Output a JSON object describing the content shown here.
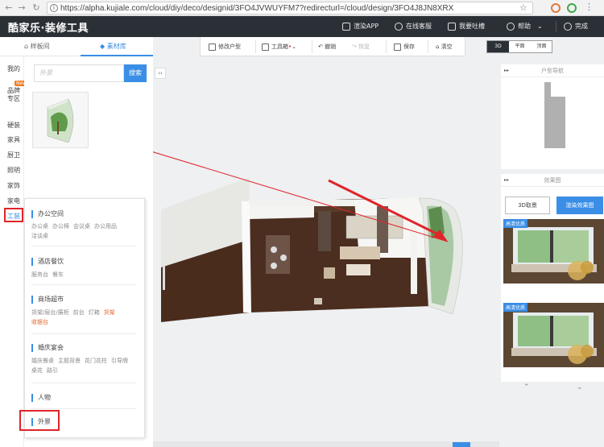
{
  "browser": {
    "url": "https://alpha.kujiale.com/cloud/diy/deco/designid/3FO4JVWUYFM7?redirecturl=/cloud/design/3FO4J8JN8XRX",
    "icons": [
      "back-icon",
      "forward-icon",
      "reload-icon",
      "info-icon",
      "star-icon"
    ]
  },
  "header": {
    "logo": "酷家乐·装修工具",
    "render_app": "渲染APP",
    "online_service": "在线客服",
    "feedback": "我要吐槽",
    "help": "帮助",
    "done": "完成"
  },
  "left_tabs": {
    "sample": "样板间",
    "material": "素材库"
  },
  "categories": [
    {
      "label": "我的"
    },
    {
      "label": "品牌专区"
    },
    {
      "label": "硬装"
    },
    {
      "label": "家具"
    },
    {
      "label": "厨卫"
    },
    {
      "label": "照明"
    },
    {
      "label": "家饰"
    },
    {
      "label": "家电"
    },
    {
      "label": "工装"
    }
  ],
  "new_badge": "New",
  "search": {
    "placeholder": "外景",
    "button": "搜索"
  },
  "popup": {
    "sections": [
      {
        "title": "办公空间",
        "items": [
          "办公桌",
          "办公椅",
          "会议桌",
          "办公用品",
          "洽谈桌"
        ]
      },
      {
        "title": "酒店餐饮",
        "items": [
          "服务台",
          "餐车"
        ]
      },
      {
        "title": "商场超市",
        "items": [
          "货架/层台/展柜",
          "前台",
          "灯箱",
          "货架",
          "收银台"
        ]
      },
      {
        "title": "婚庆宴会",
        "items": [
          "婚庆餐桌",
          "主题背景",
          "花门花柱",
          "引导牌",
          "桌花",
          "路引"
        ]
      },
      {
        "title": "人物",
        "items": []
      },
      {
        "title": "外景",
        "items": []
      }
    ]
  },
  "toolbar": {
    "edit_floorplan": "修改户型",
    "toolbox": "工具箱",
    "undo": "撤销",
    "redo": "恢复",
    "save": "保存",
    "clear": "清空"
  },
  "view_modes": [
    "3D",
    "平面",
    "顶面"
  ],
  "right": {
    "nav_title": "户型导航",
    "effect_title": "效果图",
    "capture_btn": "3D取景",
    "render_btn": "渲染效果图",
    "hq_tag": "高清优质",
    "hq_tag2": "高清优质"
  },
  "colors": {
    "accent": "#3a8ee6",
    "header_bg": "#2b3037",
    "highlight_red": "#e0242a"
  }
}
